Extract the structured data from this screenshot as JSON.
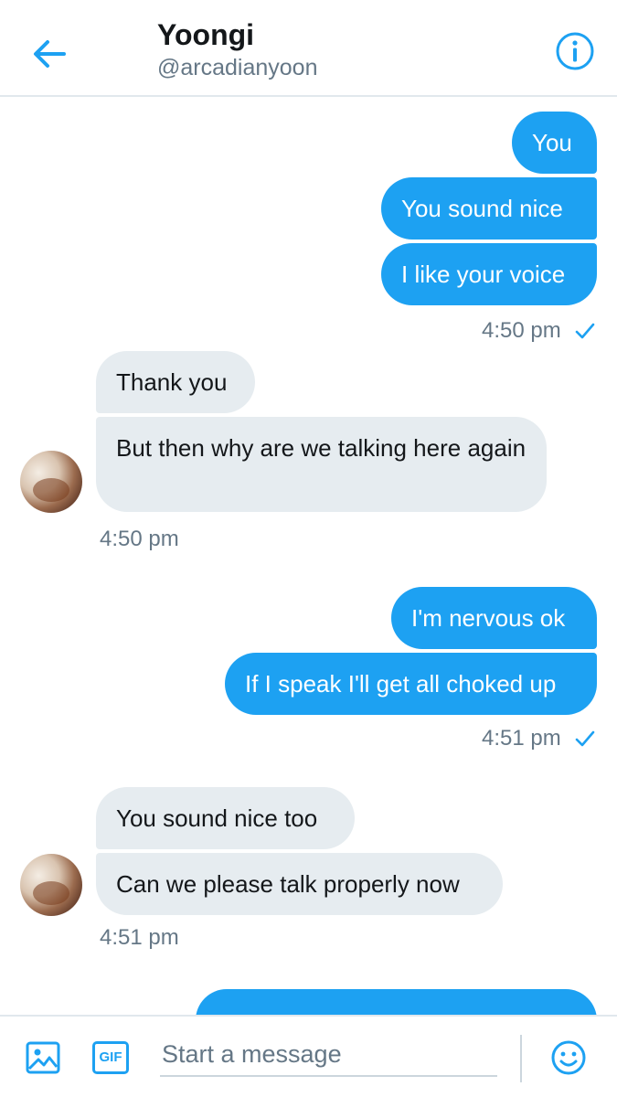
{
  "header": {
    "title": "Yoongi",
    "handle": "@arcadianyoon",
    "back_icon": "arrow-left-icon",
    "info_icon": "info-icon"
  },
  "messages": [
    {
      "side": "sent",
      "text": "You"
    },
    {
      "side": "sent",
      "text": "You sound nice"
    },
    {
      "side": "sent",
      "text": "I like your voice"
    },
    {
      "side": "sent",
      "timestamp": "4:50 pm",
      "status_icon": "check-icon"
    },
    {
      "side": "received",
      "text": "Thank you"
    },
    {
      "side": "received",
      "text": "But then why are we talking here again"
    },
    {
      "side": "received",
      "timestamp": "4:50 pm"
    },
    {
      "side": "sent",
      "text": "I'm nervous ok"
    },
    {
      "side": "sent",
      "text": "If I speak I'll get all choked up"
    },
    {
      "side": "sent",
      "timestamp": "4:51 pm",
      "status_icon": "check-icon"
    },
    {
      "side": "received",
      "text": "You sound nice too"
    },
    {
      "side": "received",
      "text": "Can we please talk properly now"
    },
    {
      "side": "received",
      "timestamp": "4:51 pm"
    }
  ],
  "composer": {
    "placeholder": "Start a message",
    "gif_label": "GIF",
    "image_icon": "image-icon",
    "emoji_icon": "smiley-icon"
  },
  "colors": {
    "accent": "#1da1f2",
    "received_bubble": "#e6ecf0",
    "secondary_text": "#657786"
  }
}
